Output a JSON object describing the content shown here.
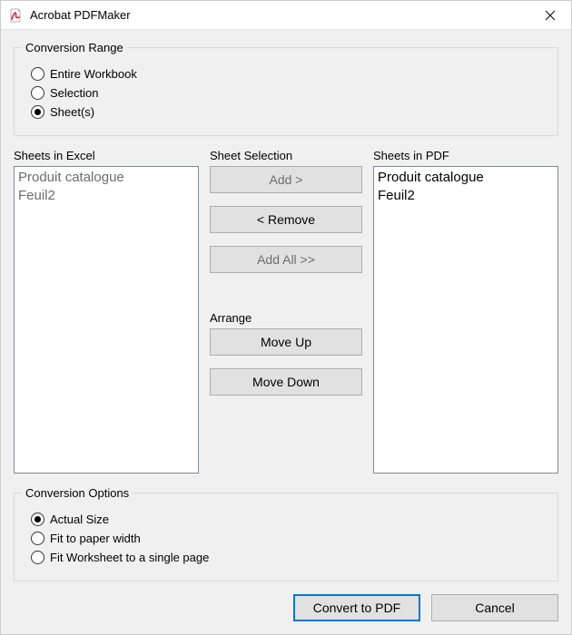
{
  "window": {
    "title": "Acrobat PDFMaker"
  },
  "conversionRange": {
    "legend": "Conversion Range",
    "options": {
      "entireWorkbook": "Entire Workbook",
      "selection": "Selection",
      "sheets": "Sheet(s)"
    },
    "selected": "sheets"
  },
  "lists": {
    "excelLabel": "Sheets in Excel",
    "pdfLabel": "Sheets in PDF",
    "excel": {
      "0": "Produit catalogue",
      "1": "Feuil2"
    },
    "pdf": {
      "0": "Produit catalogue",
      "1": "Feuil2"
    }
  },
  "sheetSelection": {
    "legend": "Sheet Selection",
    "add": "Add >",
    "remove": "< Remove",
    "addAll": "Add All >>"
  },
  "arrange": {
    "legend": "Arrange",
    "moveUp": "Move Up",
    "moveDown": "Move Down"
  },
  "conversionOptions": {
    "legend": "Conversion Options",
    "options": {
      "actualSize": "Actual Size",
      "fitWidth": "Fit to paper width",
      "fitPage": "Fit Worksheet to a single page"
    },
    "selected": "actualSize"
  },
  "footer": {
    "convert": "Convert to PDF",
    "cancel": "Cancel"
  }
}
